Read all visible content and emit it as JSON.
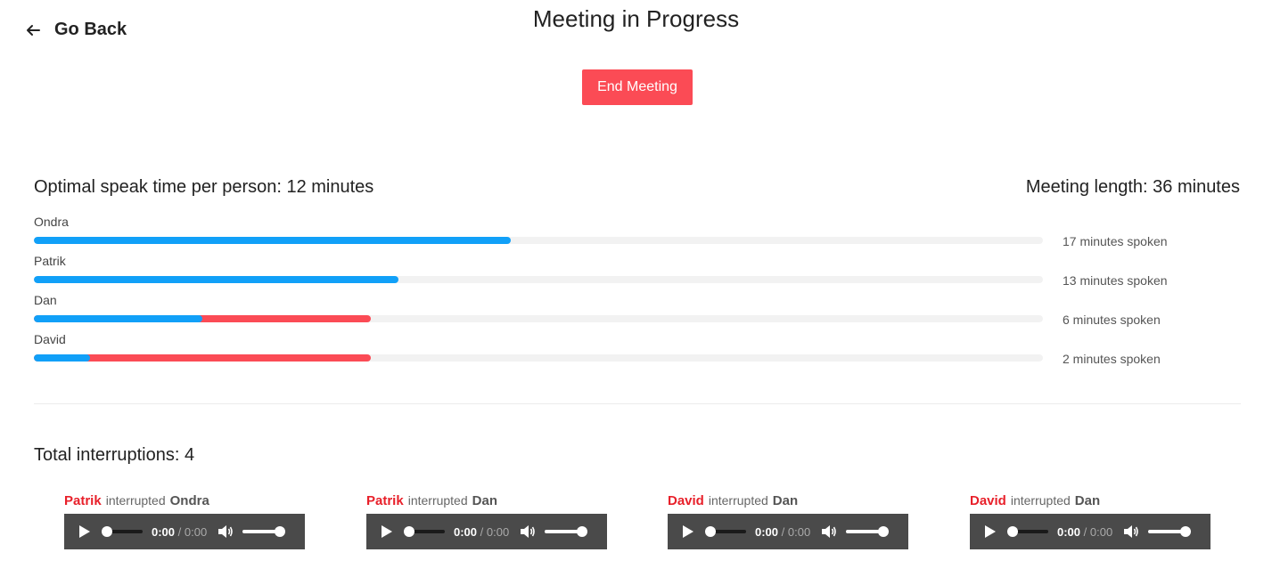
{
  "header": {
    "back_label": "Go Back",
    "title": "Meeting in Progress",
    "end_button": "End Meeting"
  },
  "colors": {
    "accent_blue": "#11a0f8",
    "accent_red": "#fb4b55",
    "interrupter_red": "#e8202a"
  },
  "stats": {
    "optimal": "Optimal speak time per person: 12 minutes",
    "length": "Meeting length: 36 minutes"
  },
  "speakers": [
    {
      "name": "Ondra",
      "spoken": "17 minutes spoken",
      "blue_fraction": 0.473,
      "red_fraction": 0.0
    },
    {
      "name": "Patrik",
      "spoken": "13 minutes spoken",
      "blue_fraction": 0.361,
      "red_fraction": 0.0
    },
    {
      "name": "Dan",
      "spoken": "6 minutes spoken",
      "blue_fraction": 0.167,
      "red_fraction": 0.334
    },
    {
      "name": "David",
      "spoken": "2 minutes spoken",
      "blue_fraction": 0.056,
      "red_fraction": 0.334
    }
  ],
  "interruptions": {
    "total": "Total interruptions: 4",
    "items": [
      {
        "who": "Patrik",
        "verb": "interrupted",
        "whom": "Ondra",
        "time": "0:00",
        "sep": "/",
        "duration": "0:00"
      },
      {
        "who": "Patrik",
        "verb": "interrupted",
        "whom": "Dan",
        "time": "0:00",
        "sep": "/",
        "duration": "0:00"
      },
      {
        "who": "David",
        "verb": "interrupted",
        "whom": "Dan",
        "time": "0:00",
        "sep": "/",
        "duration": "0:00"
      },
      {
        "who": "David",
        "verb": "interrupted",
        "whom": "Dan",
        "time": "0:00",
        "sep": "/",
        "duration": "0:00"
      }
    ]
  }
}
